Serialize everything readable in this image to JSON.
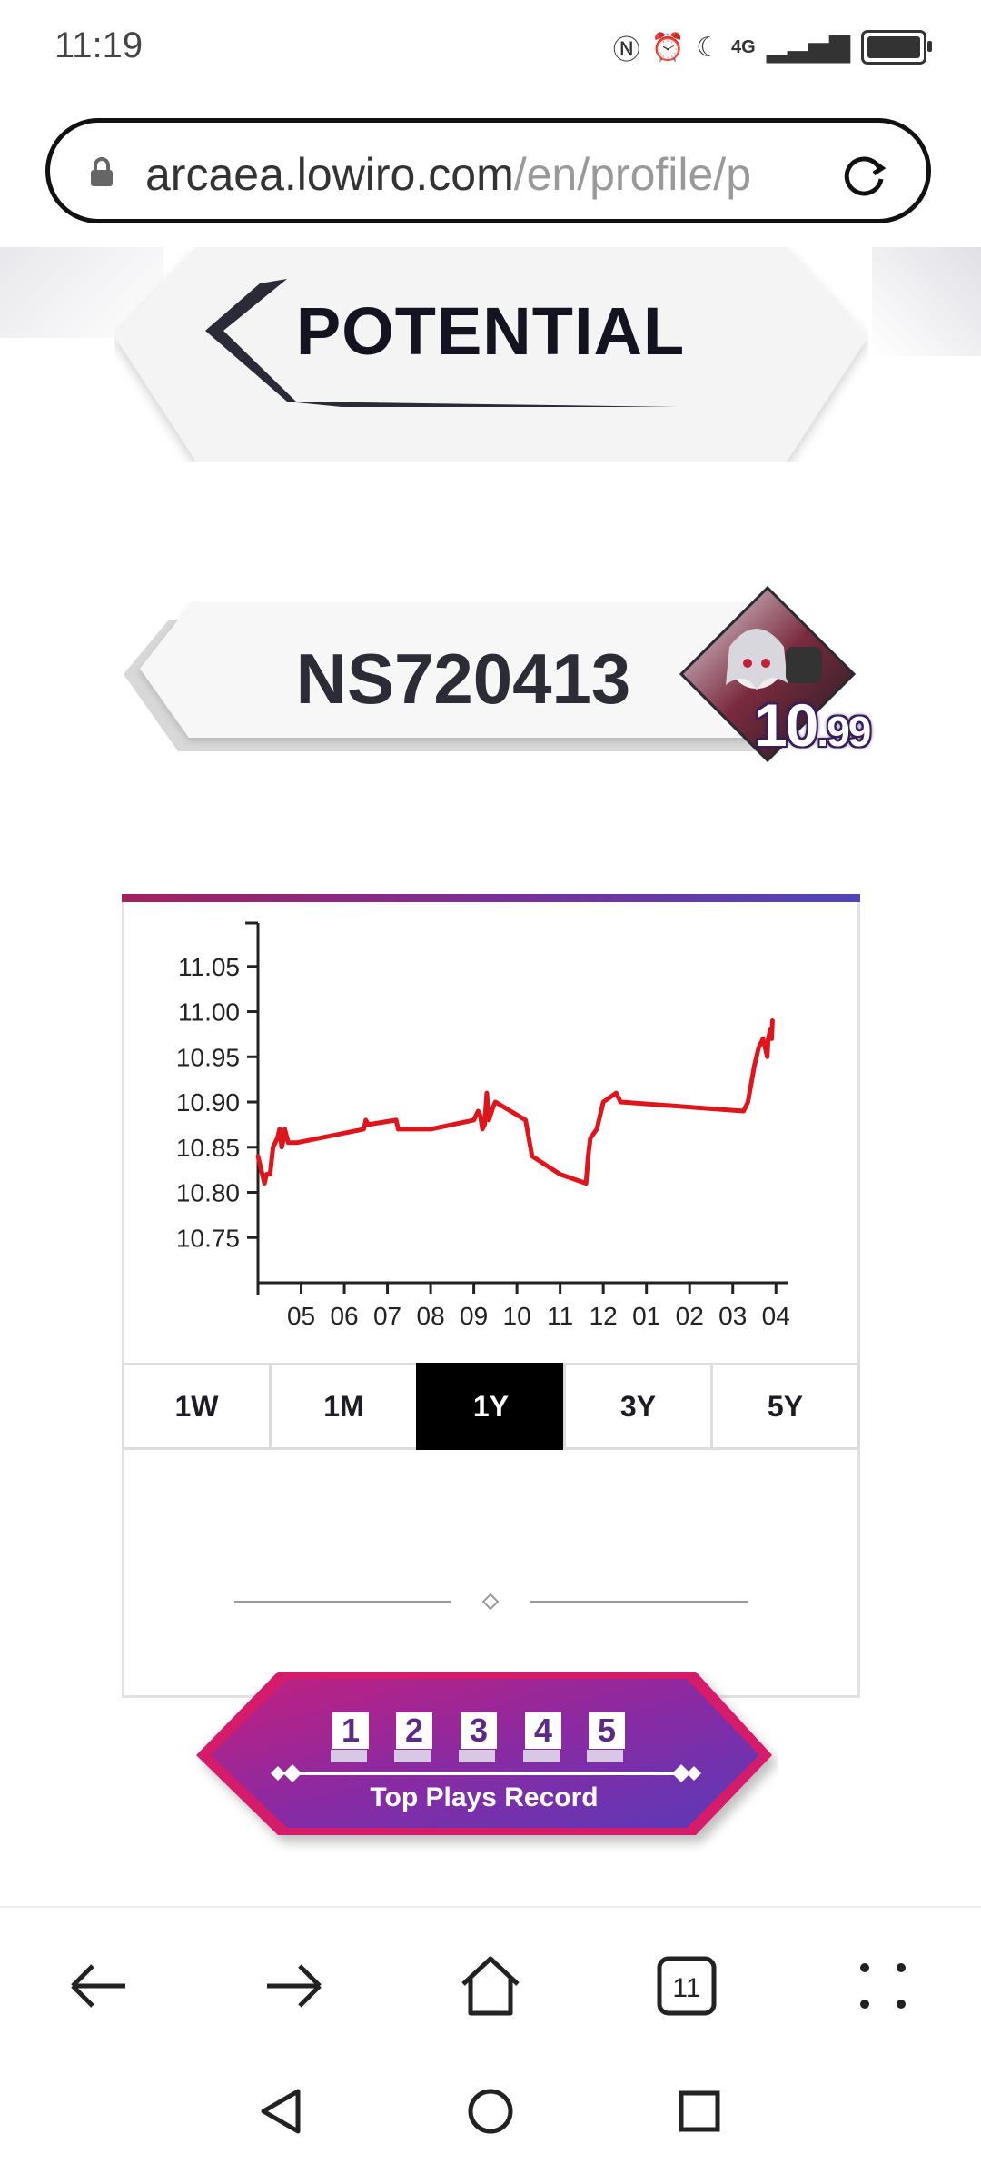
{
  "status_bar": {
    "time": "11:19",
    "network": "4G"
  },
  "browser": {
    "url_host": "arcaea.lowiro.com",
    "url_path": "/en/profile/p",
    "tab_count": "11"
  },
  "page": {
    "section_title": "POTENTIAL",
    "player_name": "NS720413",
    "potential_int": "10",
    "potential_dec": ".99",
    "range_tabs": [
      "1W",
      "1M",
      "1Y",
      "3Y",
      "5Y"
    ],
    "active_range": "1Y",
    "top_plays_label": "Top Plays Record",
    "top_plays_numbers": [
      "1",
      "2",
      "3",
      "4",
      "5"
    ]
  },
  "colors": {
    "chart_line": "#e0141b",
    "gradient_start": "#a4205e",
    "gradient_end": "#4f46b9",
    "active_tab": "#000000"
  },
  "chart_data": {
    "type": "line",
    "title": "",
    "xlabel": "",
    "ylabel": "",
    "x_ticks": [
      "05",
      "06",
      "07",
      "08",
      "09",
      "10",
      "11",
      "12",
      "01",
      "02",
      "03",
      "04"
    ],
    "y_ticks": [
      "10.75",
      "10.80",
      "10.85",
      "10.90",
      "10.95",
      "11.00",
      "11.05"
    ],
    "ylim": [
      10.7,
      11.09
    ],
    "xlim": [
      4.0,
      16.1
    ],
    "series": [
      {
        "x": [
          4.0,
          4.05,
          4.15,
          4.2,
          4.28,
          4.35,
          4.45,
          4.5,
          4.55,
          4.6,
          4.62,
          4.7,
          4.8,
          4.85,
          4.9,
          6.45,
          6.5,
          6.55,
          7.2,
          7.25,
          8.0,
          9.0,
          9.1,
          9.15,
          9.2,
          9.25,
          9.3,
          9.35,
          9.45,
          9.5,
          10.2,
          10.35,
          11.0,
          11.6,
          11.65,
          11.7,
          11.85,
          12.0,
          12.3,
          12.4,
          15.25,
          15.35,
          15.5,
          15.6,
          15.7,
          15.75,
          15.8,
          15.82,
          15.87,
          15.9,
          15.92
        ],
        "y": [
          10.84,
          10.83,
          10.81,
          10.82,
          10.82,
          10.85,
          10.86,
          10.87,
          10.85,
          10.86,
          10.87,
          10.855,
          10.855,
          10.855,
          10.855,
          10.87,
          10.88,
          10.875,
          10.88,
          10.87,
          10.87,
          10.88,
          10.89,
          10.885,
          10.87,
          10.875,
          10.91,
          10.88,
          10.895,
          10.9,
          10.88,
          10.84,
          10.82,
          10.81,
          10.84,
          10.86,
          10.87,
          10.9,
          10.91,
          10.9,
          10.89,
          10.9,
          10.94,
          10.96,
          10.97,
          10.96,
          10.95,
          10.97,
          10.98,
          10.97,
          10.99
        ]
      }
    ]
  }
}
